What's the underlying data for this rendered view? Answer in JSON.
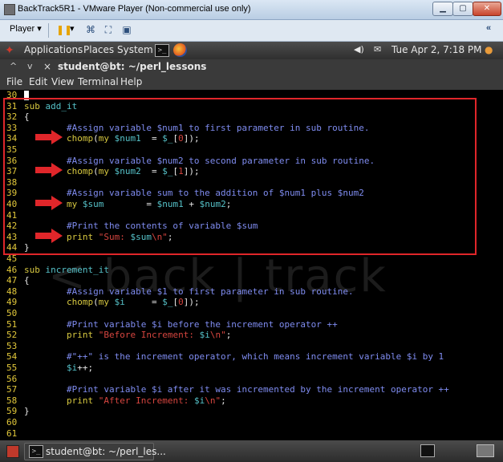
{
  "window": {
    "title": "BackTrack5R1 - VMware Player (Non-commercial use only)",
    "controls": {
      "minimize": "▁",
      "maximize": "▢",
      "close": "✕"
    }
  },
  "vmware_toolbar": {
    "player_label": "Player",
    "player_arrow": "▾",
    "pause_arrow": "▾",
    "right_chevron": "«"
  },
  "gnome_panel": {
    "applications": "Applications",
    "places": "Places",
    "system": "System",
    "terminal_icon": ">_",
    "datetime": "Tue Apr  2,  7:18 PM"
  },
  "terminal_tab": {
    "up_arrow": "^",
    "down_arrow": "v",
    "close": "×",
    "title": "student@bt: ~/perl_lessons"
  },
  "terminal_menu": [
    "File",
    "Edit",
    "View",
    "Terminal",
    "Help"
  ],
  "code_lines": [
    {
      "n": "30",
      "parts": [],
      "cursor": true
    },
    {
      "n": "31",
      "parts": [
        [
          "kw",
          "sub "
        ],
        [
          "fn",
          "add_it"
        ]
      ]
    },
    {
      "n": "32",
      "parts": [
        [
          "punc",
          "{"
        ]
      ]
    },
    {
      "n": "33",
      "parts": [
        [
          "cm",
          "        #Assign variable $num1 to first parameter in sub routine."
        ]
      ]
    },
    {
      "n": "34",
      "parts": [
        [
          "punc",
          "        "
        ],
        [
          "kw",
          "chomp"
        ],
        [
          "punc",
          "("
        ],
        [
          "kw",
          "my "
        ],
        [
          "var",
          "$num1"
        ],
        [
          "punc",
          "  = "
        ],
        [
          "var",
          "$_"
        ],
        [
          "punc",
          "["
        ],
        [
          "str",
          "0"
        ],
        [
          "punc",
          "]);"
        ]
      ]
    },
    {
      "n": "35",
      "parts": []
    },
    {
      "n": "36",
      "parts": [
        [
          "cm",
          "        #Assign variable $num2 to second parameter in sub routine."
        ]
      ]
    },
    {
      "n": "37",
      "parts": [
        [
          "punc",
          "        "
        ],
        [
          "kw",
          "chomp"
        ],
        [
          "punc",
          "("
        ],
        [
          "kw",
          "my "
        ],
        [
          "var",
          "$num2"
        ],
        [
          "punc",
          "  = "
        ],
        [
          "var",
          "$_"
        ],
        [
          "punc",
          "["
        ],
        [
          "str",
          "1"
        ],
        [
          "punc",
          "]);"
        ]
      ]
    },
    {
      "n": "38",
      "parts": []
    },
    {
      "n": "39",
      "parts": [
        [
          "cm",
          "        #Assign variable sum to the addition of $num1 plus $num2"
        ]
      ]
    },
    {
      "n": "40",
      "parts": [
        [
          "punc",
          "        "
        ],
        [
          "kw",
          "my "
        ],
        [
          "var",
          "$sum"
        ],
        [
          "punc",
          "        = "
        ],
        [
          "var",
          "$num1"
        ],
        [
          "punc",
          " + "
        ],
        [
          "var",
          "$num2"
        ],
        [
          "punc",
          ";"
        ]
      ]
    },
    {
      "n": "41",
      "parts": []
    },
    {
      "n": "42",
      "parts": [
        [
          "cm",
          "        #Print the contents of variable $sum"
        ]
      ]
    },
    {
      "n": "43",
      "parts": [
        [
          "punc",
          "        "
        ],
        [
          "kw",
          "print "
        ],
        [
          "str",
          "\"Sum: "
        ],
        [
          "var",
          "$sum"
        ],
        [
          "str",
          "\\n\""
        ],
        [
          "punc",
          ";"
        ]
      ]
    },
    {
      "n": "44",
      "parts": [
        [
          "punc",
          "}"
        ]
      ]
    },
    {
      "n": "45",
      "parts": []
    },
    {
      "n": "46",
      "parts": [
        [
          "kw",
          "sub "
        ],
        [
          "fn",
          "increment_it"
        ]
      ]
    },
    {
      "n": "47",
      "parts": [
        [
          "punc",
          "{"
        ]
      ]
    },
    {
      "n": "48",
      "parts": [
        [
          "cm",
          "        #Assign variable $1 to first parameter in sub routine."
        ]
      ]
    },
    {
      "n": "49",
      "parts": [
        [
          "punc",
          "        "
        ],
        [
          "kw",
          "chomp"
        ],
        [
          "punc",
          "("
        ],
        [
          "kw",
          "my "
        ],
        [
          "var",
          "$i"
        ],
        [
          "punc",
          "     = "
        ],
        [
          "var",
          "$_"
        ],
        [
          "punc",
          "["
        ],
        [
          "str",
          "0"
        ],
        [
          "punc",
          "]);"
        ]
      ]
    },
    {
      "n": "50",
      "parts": []
    },
    {
      "n": "51",
      "parts": [
        [
          "cm",
          "        #Print variable $i before the increment operator ++"
        ]
      ]
    },
    {
      "n": "52",
      "parts": [
        [
          "punc",
          "        "
        ],
        [
          "kw",
          "print "
        ],
        [
          "str",
          "\"Before Increment: "
        ],
        [
          "var",
          "$i"
        ],
        [
          "str",
          "\\n\""
        ],
        [
          "punc",
          ";"
        ]
      ]
    },
    {
      "n": "53",
      "parts": []
    },
    {
      "n": "54",
      "parts": [
        [
          "cm",
          "        #\"++\" is the increment operator, which means increment variable $i by 1"
        ]
      ]
    },
    {
      "n": "55",
      "parts": [
        [
          "punc",
          "        "
        ],
        [
          "var",
          "$i"
        ],
        [
          "punc",
          "++;"
        ]
      ]
    },
    {
      "n": "56",
      "parts": []
    },
    {
      "n": "57",
      "parts": [
        [
          "cm",
          "        #Print variable $i after it was incremented by the increment operator ++"
        ]
      ]
    },
    {
      "n": "58",
      "parts": [
        [
          "punc",
          "        "
        ],
        [
          "kw",
          "print "
        ],
        [
          "str",
          "\"After Increment: "
        ],
        [
          "var",
          "$i"
        ],
        [
          "str",
          "\\n\""
        ],
        [
          "punc",
          ";"
        ]
      ]
    },
    {
      "n": "59",
      "parts": [
        [
          "punc",
          "}"
        ]
      ]
    },
    {
      "n": "60",
      "parts": []
    },
    {
      "n": "61",
      "parts": []
    }
  ],
  "taskbar": {
    "task_label": "student@bt: ~/perl_les..."
  },
  "colors": {
    "highlight_box": "#e0262a",
    "arrow": "#e0262a"
  }
}
